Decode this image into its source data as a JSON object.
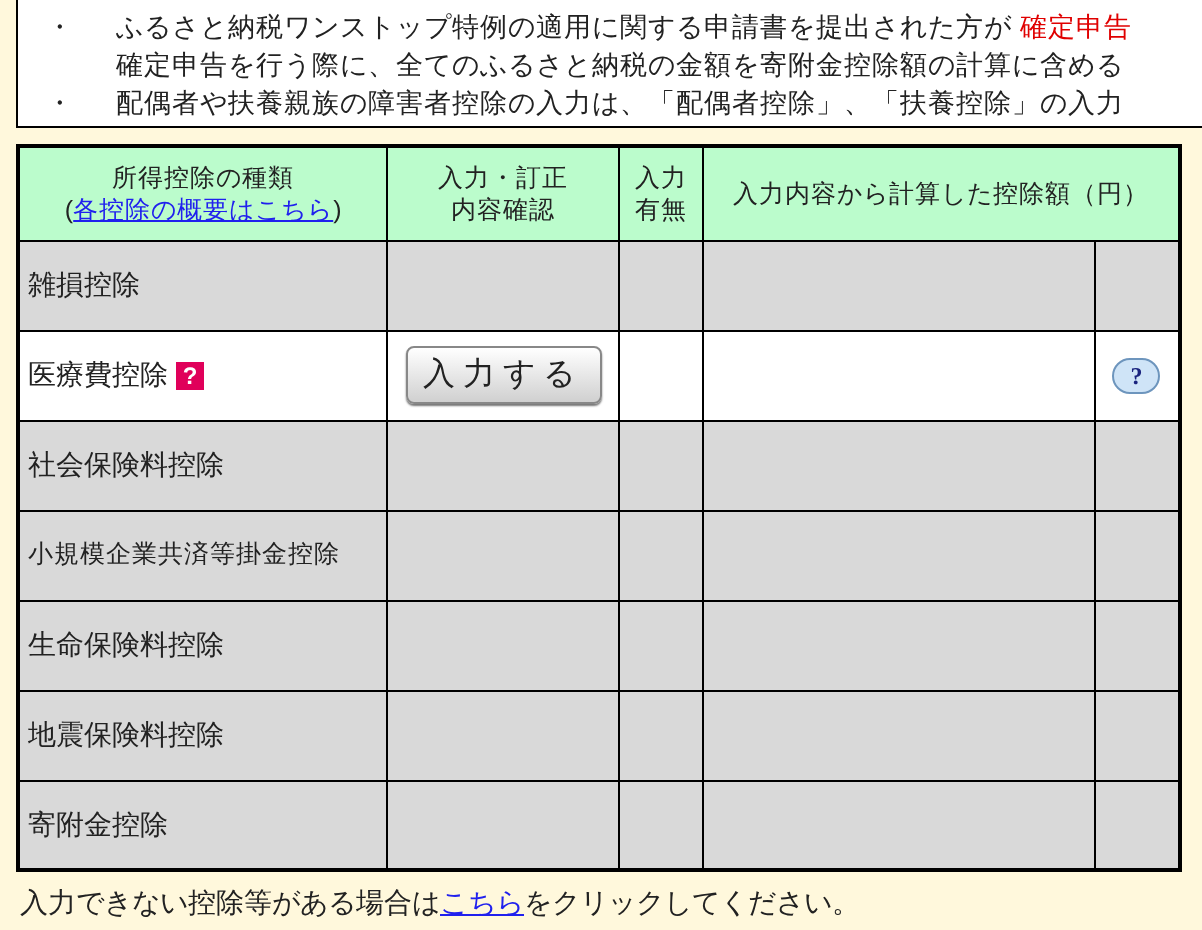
{
  "notice": {
    "items": [
      {
        "lines": [
          {
            "text": "ふるさと納税ワンストップ特例の適用に関する申請書を提出された方が ",
            "emphasis": "確定申告"
          },
          {
            "text": "確定申告を行う際に、全てのふるさと納税の金額を寄附金控除額の計算に含める"
          }
        ]
      },
      {
        "lines": [
          {
            "text": "配偶者や扶養親族の障害者控除の入力は、「配偶者控除」、「扶養控除」の入力"
          }
        ]
      }
    ],
    "bullet": "・"
  },
  "table": {
    "columns": [
      {
        "lines": [
          "所得控除の種類"
        ],
        "link_prefix": "(",
        "link": "各控除の概要はこちら",
        "link_suffix": ")"
      },
      {
        "lines": [
          "入力・訂正",
          "内容確認"
        ]
      },
      {
        "lines": [
          "入力",
          "有無"
        ]
      },
      {
        "lines": [
          "入力内容から計算した控除額（円）"
        ]
      }
    ],
    "rows": [
      {
        "name": "雑損控除",
        "disabled": true
      },
      {
        "name": "医療費控除",
        "disabled": false,
        "help": "?",
        "button": "入力する",
        "bubble_help": "?"
      },
      {
        "name": "社会保険料控除",
        "disabled": true
      },
      {
        "name": "小規模企業共済等掛金控除",
        "disabled": true,
        "small": true
      },
      {
        "name": "生命保険料控除",
        "disabled": true
      },
      {
        "name": "地震保険料控除",
        "disabled": true
      },
      {
        "name": "寄附金控除",
        "disabled": true
      }
    ]
  },
  "footer": {
    "before": "入力できない控除等がある場合は",
    "link": "こちら",
    "after": "をクリックしてください。"
  }
}
